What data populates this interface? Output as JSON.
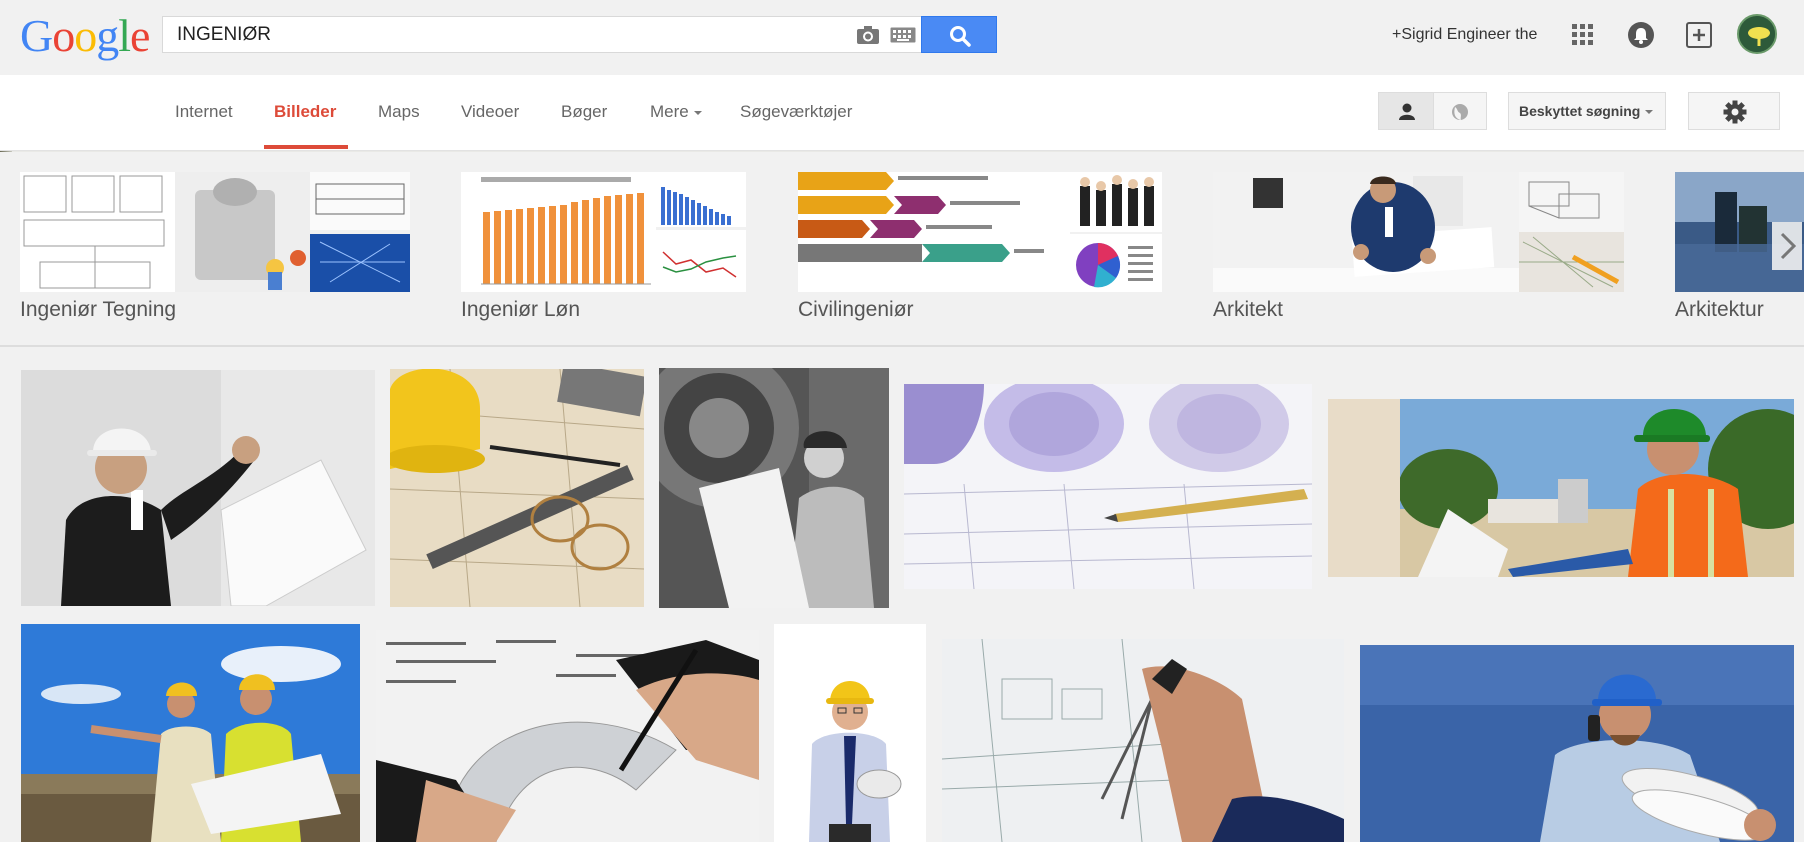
{
  "header": {
    "logo_letters": [
      "G",
      "o",
      "o",
      "g",
      "l",
      "e"
    ],
    "search_value": "INGENIØR",
    "account_name": "+Sigrid Engineer the"
  },
  "nav": {
    "items": [
      "Internet",
      "Billeder",
      "Maps",
      "Videoer",
      "Bøger",
      "Mere",
      "Søgeværktøjer"
    ],
    "active": "Billeder",
    "safe_search": "Beskyttet søgning"
  },
  "related": [
    {
      "label": "Ingeniør Tegning"
    },
    {
      "label": "Ingeniør Løn"
    },
    {
      "label": "Civilingeniør"
    },
    {
      "label": "Arkitekt"
    },
    {
      "label": "Arkitektur"
    }
  ],
  "colors": {
    "accent": "#dd4b39",
    "search_blue": "#4a8af4",
    "logo": [
      "#4285f4",
      "#ea4335",
      "#fbbc05",
      "#4285f4",
      "#34a853",
      "#ea4335"
    ]
  }
}
